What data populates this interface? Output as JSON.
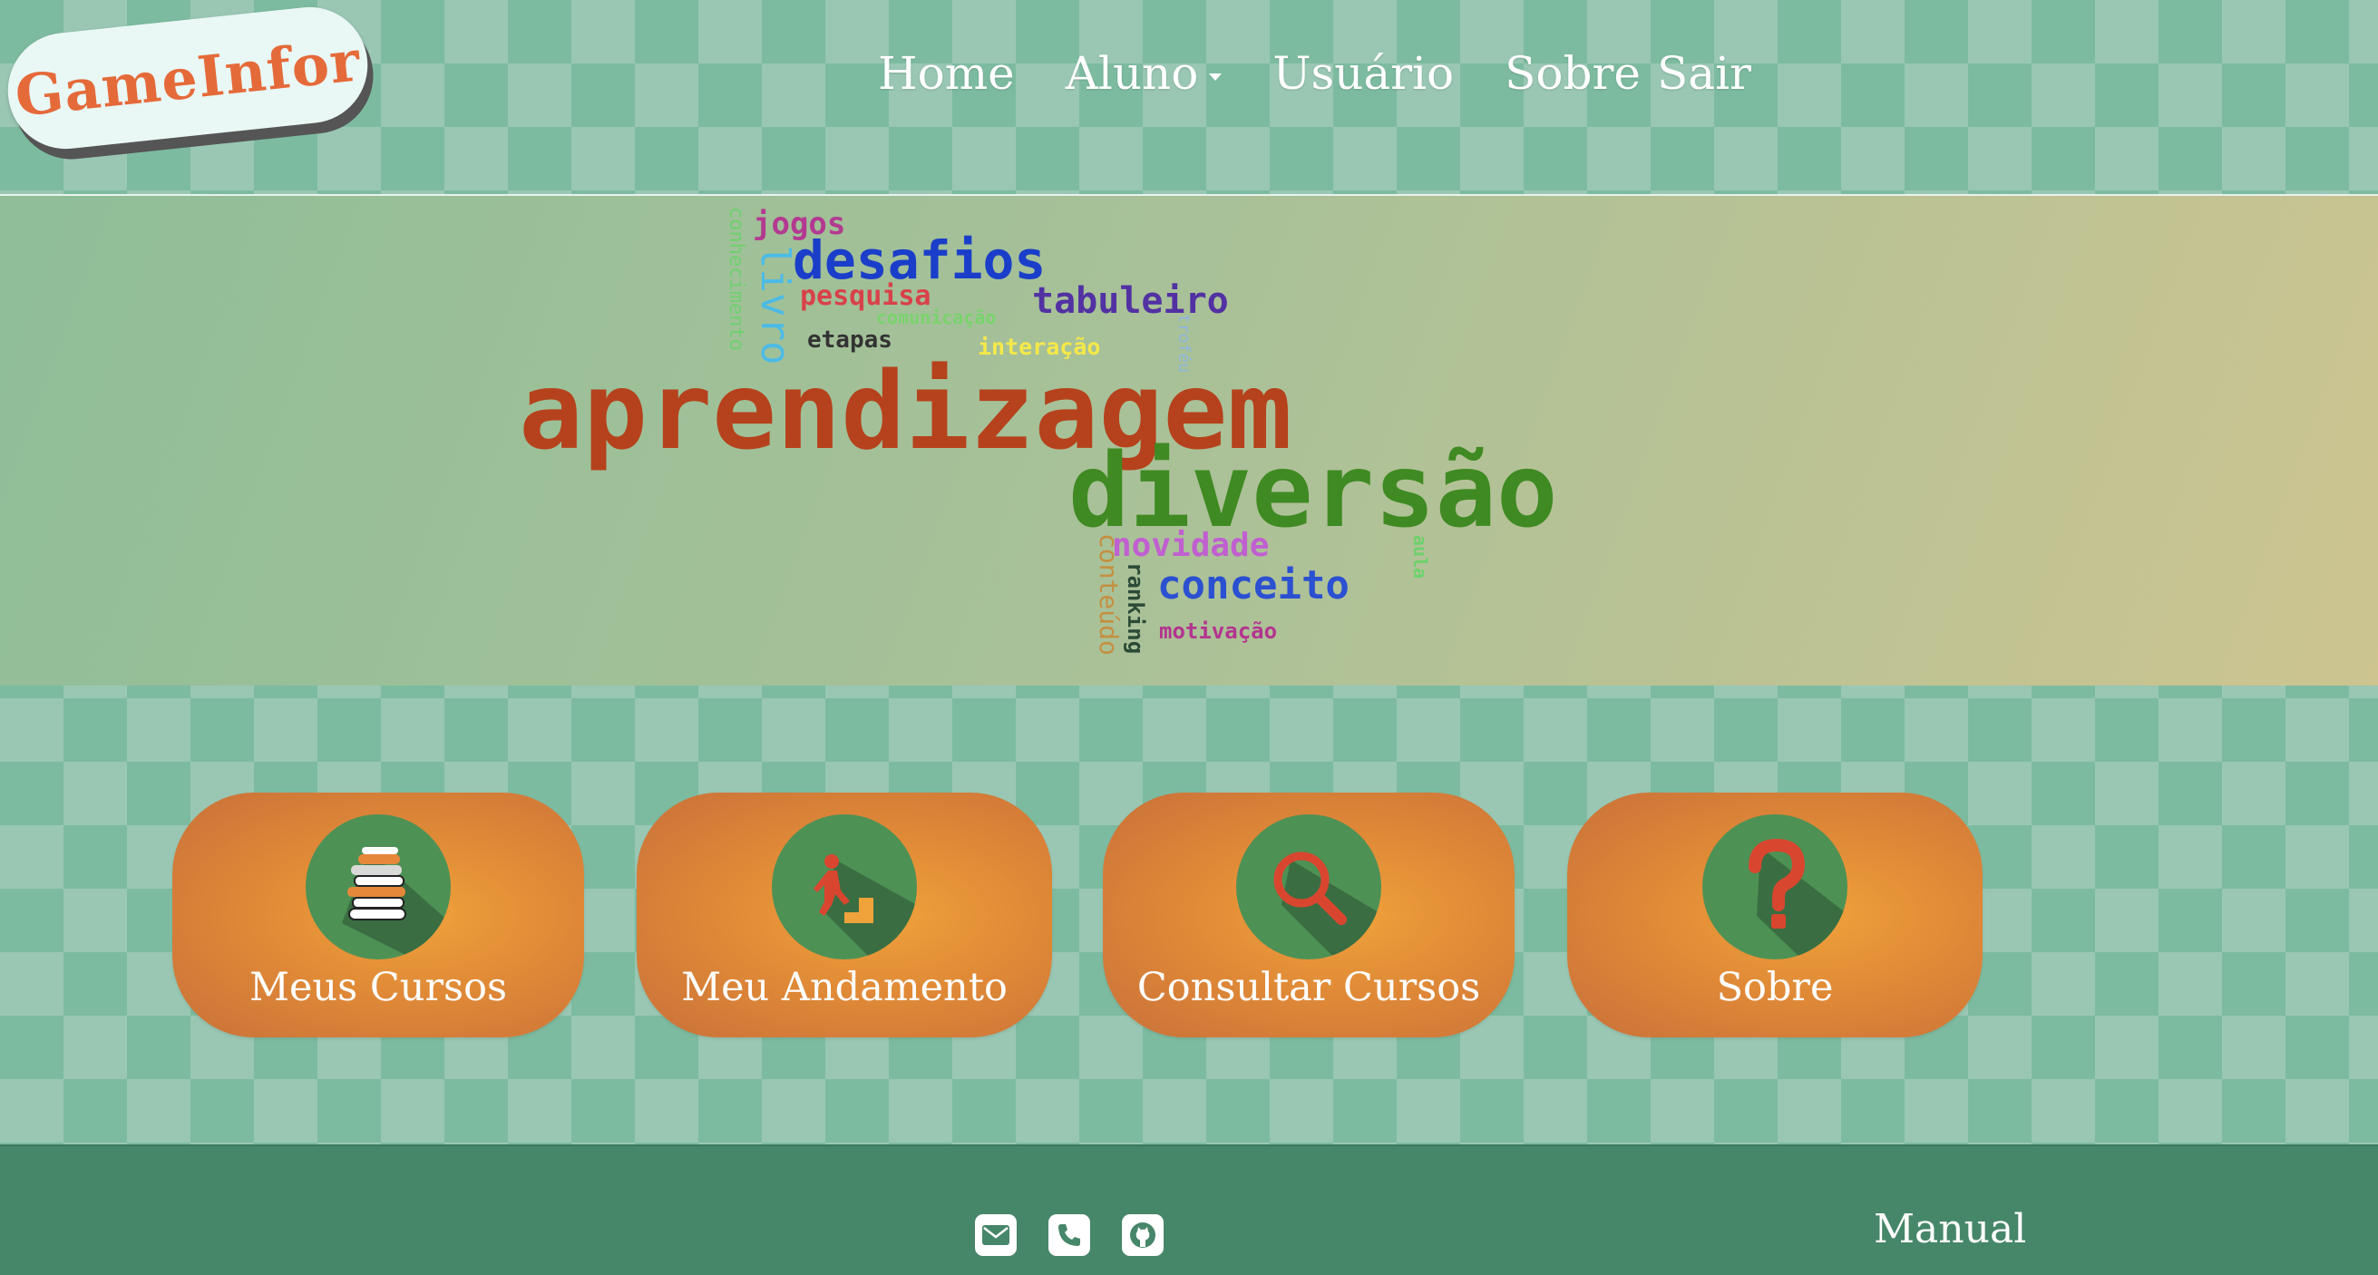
{
  "header": {
    "logo_text": "GameInfor",
    "nav": {
      "home": "Home",
      "aluno": "Aluno",
      "usuario": "Usuário",
      "sobre": "Sobre",
      "sair": "Sair"
    }
  },
  "banner": {
    "words": {
      "aprendizagem": "aprendizagem",
      "diversao": "diversão",
      "desafios": "desafios",
      "tabuleiro": "tabuleiro",
      "jogos": "jogos",
      "pesquisa": "pesquisa",
      "comunicacao": "comunicação",
      "etapas": "etapas",
      "interacao": "interação",
      "livro": "livro",
      "conhecimento": "conhecimento",
      "trofeu": "troféu",
      "novidade": "novidade",
      "conceito": "conceito",
      "conteudo": "conteúdo",
      "ranking": "ranking",
      "motivacao": "motivação",
      "aula": "aula"
    }
  },
  "cards": {
    "meus_cursos": "Meus Cursos",
    "meu_andamento": "Meu Andamento",
    "consultar_cursos": "Consultar Cursos",
    "sobre": "Sobre"
  },
  "footer": {
    "manual": "Manual",
    "icons": [
      "envelope-icon",
      "phone-icon",
      "github-icon"
    ]
  },
  "colors": {
    "card_orange": "#e08a37",
    "icon_green": "#4e9155",
    "footer_green": "#468669",
    "logo_text": "#e56a3a"
  }
}
